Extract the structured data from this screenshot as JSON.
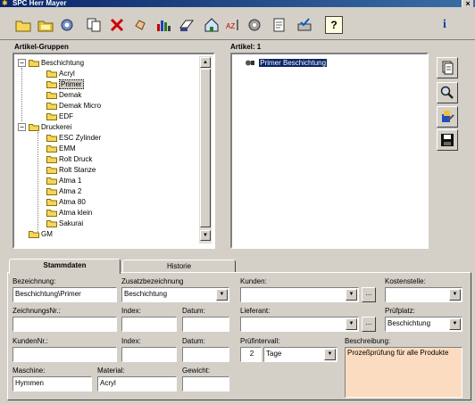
{
  "window": {
    "title": "SPC Herr Mayer",
    "close_glyph": "×"
  },
  "toolbar": {
    "icons": [
      "new-folder-icon",
      "open-folder-icon",
      "settings-icon",
      "copy-icon",
      "delete-icon",
      "hand-icon",
      "chart-icon",
      "print-icon",
      "house-icon",
      "sort-icon",
      "tools-icon",
      "notepad-icon",
      "printer-check-icon",
      "help-icon",
      "info-icon"
    ],
    "help_label": "?",
    "info_label": "i"
  },
  "groups_panel": {
    "label": "Artikel-Gruppen",
    "tree": [
      {
        "label": "Beschichtung",
        "level": 0,
        "expander": "−"
      },
      {
        "label": "Acryl",
        "level": 1
      },
      {
        "label": "Primer",
        "level": 1,
        "selected": true
      },
      {
        "label": "Demak",
        "level": 1
      },
      {
        "label": "Demak Micro",
        "level": 1
      },
      {
        "label": "EDF",
        "level": 1
      },
      {
        "label": "Druckerei",
        "level": 0,
        "expander": "−"
      },
      {
        "label": "ESC Zylinder",
        "level": 1
      },
      {
        "label": "EMM",
        "level": 1
      },
      {
        "label": "Rolt Druck",
        "level": 1
      },
      {
        "label": "Rolt Stanze",
        "level": 1
      },
      {
        "label": "Atma 1",
        "level": 1
      },
      {
        "label": "Atma 2",
        "level": 1
      },
      {
        "label": "Atma 80",
        "level": 1
      },
      {
        "label": "Atma klein",
        "level": 1
      },
      {
        "label": "Sakurai",
        "level": 1
      },
      {
        "label": "GM",
        "level": 0
      }
    ]
  },
  "articles_panel": {
    "label": "Artikel:",
    "count": "1",
    "items": [
      {
        "label": "Primer Beschichtung",
        "selected": true
      }
    ],
    "side_icons": [
      "document-icon",
      "magnifier-icon",
      "edit-icon",
      "save-icon"
    ]
  },
  "tabs": [
    {
      "label": "Stammdaten",
      "active": true
    },
    {
      "label": "Historie",
      "active": false
    }
  ],
  "form": {
    "bezeichnung": {
      "label": "Bezeichnung:",
      "value": "Beschichtung\\Primer"
    },
    "zusatz": {
      "label": "Zusatzbezeichnung",
      "value": "Beschichtung"
    },
    "kunden": {
      "label": "Kunden:",
      "value": ""
    },
    "kostenstelle": {
      "label": "Kostenstelle:",
      "value": ""
    },
    "zeichnungsnr": {
      "label": "ZeichnungsNr.:",
      "value": ""
    },
    "index1": {
      "label": "Index:",
      "value": ""
    },
    "datum1": {
      "label": "Datum:",
      "value": ""
    },
    "lieferant": {
      "label": "Lieferant:",
      "value": ""
    },
    "pruefplatz": {
      "label": "Prüfplatz:",
      "value": "Beschichtung"
    },
    "kundennr": {
      "label": "KundenNr.:",
      "value": ""
    },
    "index2": {
      "label": "Index:",
      "value": ""
    },
    "datum2": {
      "label": "Datum:",
      "value": ""
    },
    "pruefintervall": {
      "label": "Prüfintervall:",
      "number": "2",
      "unit": "Tage"
    },
    "beschreibung": {
      "label": "Beschreibung:",
      "value": "Prozeßprüfung für alle Produkte"
    },
    "maschine": {
      "label": "Maschine:",
      "value": "Hymmen"
    },
    "material": {
      "label": "Material:",
      "value": "Acryl"
    },
    "gewicht": {
      "label": "Gewicht:",
      "value": ""
    },
    "dots": "..."
  },
  "colors": {
    "titlebar": "#0a246a",
    "selection": "#0a246a",
    "beschreibung_bg": "#fbdcc0"
  }
}
